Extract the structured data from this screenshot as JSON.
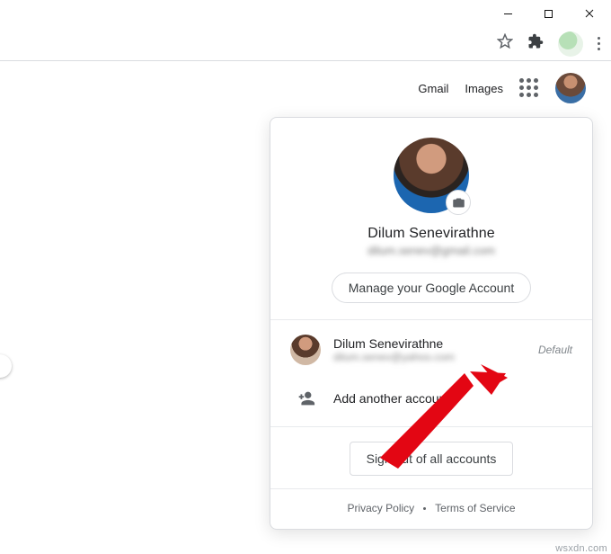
{
  "window_controls": {
    "minimize": "minimize",
    "maximize": "maximize",
    "close": "close"
  },
  "header": {
    "gmail": "Gmail",
    "images": "Images"
  },
  "account_menu": {
    "name": "Dilum Senevirathne",
    "email_masked": "dilum.senev@gmail.com",
    "manage_label": "Manage your Google Account",
    "accounts": [
      {
        "name": "Dilum Senevirathne",
        "email_masked": "dilum.senev@yahoo.com",
        "badge": "Default"
      }
    ],
    "add_another_label": "Add another account",
    "signout_label": "Sign out of all accounts",
    "footer": {
      "privacy": "Privacy Policy",
      "terms": "Terms of Service"
    }
  },
  "watermark": "wsxdn.com"
}
